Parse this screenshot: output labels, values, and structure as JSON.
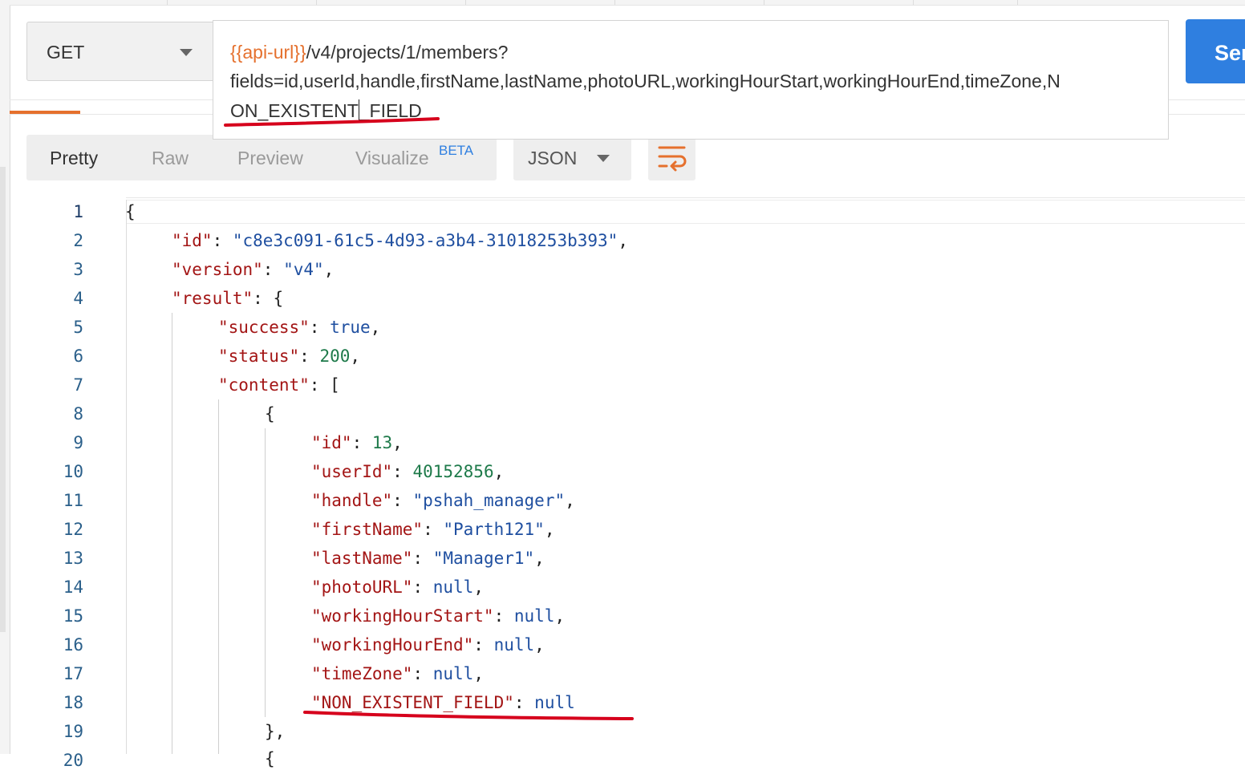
{
  "request": {
    "method": "GET",
    "url_variable": "{{api-url}}",
    "url_path": "/v4/projects/1/members?",
    "url_line2": "fields=id,userId,handle,firstName,lastName,photoURL,workingHourStart,workingHourEnd,timeZone,N",
    "url_line3_before_cursor": "ON_EXISTENT",
    "url_line3_after_cursor": "_FIELD",
    "send_label": "Ser"
  },
  "response_view": {
    "tabs": [
      "Pretty",
      "Raw",
      "Preview",
      "Visualize"
    ],
    "beta_badge": "BETA",
    "format": "JSON"
  },
  "code": {
    "line_numbers": [
      "1",
      "2",
      "3",
      "4",
      "5",
      "6",
      "7",
      "8",
      "9",
      "10",
      "11",
      "12",
      "13",
      "14",
      "15",
      "16",
      "17",
      "18",
      "19",
      "20"
    ],
    "lines": {
      "l1": "{",
      "id_key": "\"id\"",
      "id_val": "\"c8e3c091-61c5-4d93-a3b4-31018253b393\"",
      "version_key": "\"version\"",
      "version_val": "\"v4\"",
      "result_key": "\"result\"",
      "success_key": "\"success\"",
      "success_val": "true",
      "status_key": "\"status\"",
      "status_val": "200",
      "content_key": "\"content\"",
      "open_obj": "{",
      "m_id_key": "\"id\"",
      "m_id_val": "13",
      "userid_key": "\"userId\"",
      "userid_val": "40152856",
      "handle_key": "\"handle\"",
      "handle_val": "\"pshah_manager\"",
      "first_key": "\"firstName\"",
      "first_val": "\"Parth121\"",
      "last_key": "\"lastName\"",
      "last_val": "\"Manager1\"",
      "photo_key": "\"photoURL\"",
      "null": "null",
      "whs_key": "\"workingHourStart\"",
      "whe_key": "\"workingHourEnd\"",
      "tz_key": "\"timeZone\"",
      "nef_key": "\"NON_EXISTENT_FIELD\"",
      "close_obj": "},",
      "next_obj": "{"
    }
  },
  "colors": {
    "send_button": "#2f7fe0",
    "variable": "#e5702d",
    "json_key": "#a31515",
    "json_string": "#1f4fa0",
    "json_number": "#1e7a4a",
    "annotation": "#d6001c"
  }
}
